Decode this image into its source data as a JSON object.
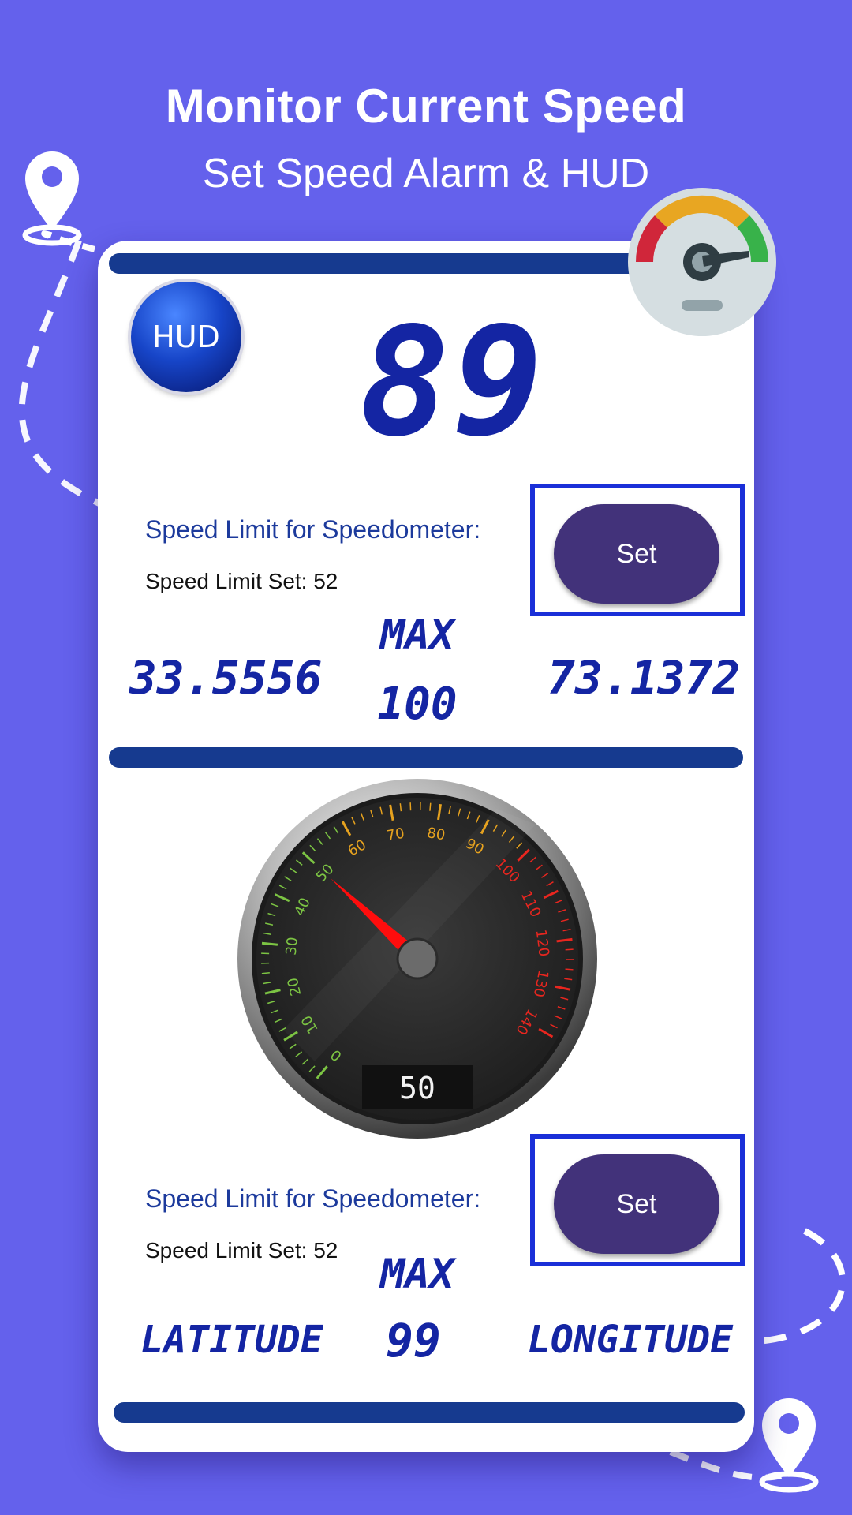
{
  "header": {
    "title": "Monitor Current Speed",
    "subtitle": "Set Speed Alarm & HUD"
  },
  "digital_panel": {
    "hud_label": "HUD",
    "current_speed": "89",
    "speed_limit_title": "Speed Limit for Speedometer:",
    "speed_limit_set": "Speed Limit Set: 52",
    "set_label": "Set",
    "latitude_value": "33.5556",
    "max_label": "MAX",
    "max_value": "100",
    "longitude_value": "73.1372"
  },
  "analog_panel": {
    "gauge_ticks": [
      "0",
      "10",
      "20",
      "30",
      "40",
      "50",
      "60",
      "70",
      "80",
      "90",
      "100",
      "110",
      "120",
      "130",
      "140"
    ],
    "gauge_readout": "50",
    "needle_speed": 50,
    "speed_limit_title": "Speed Limit for Speedometer:",
    "speed_limit_set": "Speed Limit Set: 52",
    "set_label": "Set",
    "max_label": "MAX",
    "max_value": "99",
    "latitude_label": "LATITUDE",
    "longitude_label": "LONGITUDE"
  },
  "colors": {
    "background": "#6461ec",
    "accent_bar": "#163a8f",
    "button": "#42327a",
    "digital_text": "#1425a3",
    "needle": "#ff0d0d"
  },
  "icons": [
    "map-pin-icon",
    "speedometer-icon",
    "hud-icon"
  ]
}
